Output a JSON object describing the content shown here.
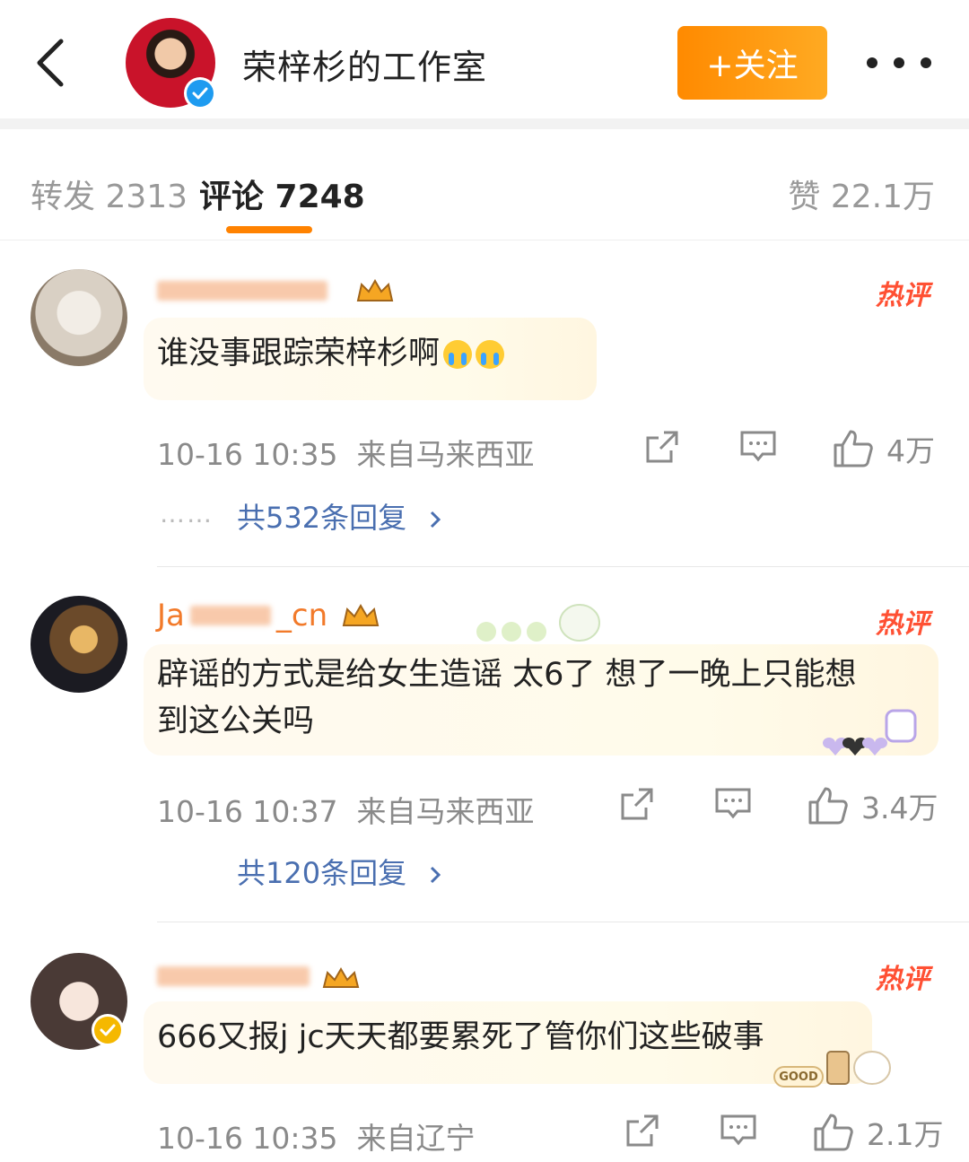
{
  "header": {
    "title": "荣梓杉的工作室",
    "follow_label": "+关注"
  },
  "tabs": {
    "repost": "转发 2313",
    "comment": "评论 7248",
    "like": "赞 22.1万"
  },
  "comments": [
    {
      "username_partial": "",
      "hot_label": "热评",
      "text": "谁没事跟踪荣梓杉啊",
      "time": "10-16 10:35",
      "location": "来自马来西亚",
      "likes": "4万",
      "replies": "共532条回复",
      "reply_ellipsis": "……"
    },
    {
      "username_partial": "Ja",
      "username_suffix": "_cn",
      "hot_label": "热评",
      "text": "辟谣的方式是给女生造谣 太6了 想了一晚上只能想到这公关吗",
      "text_line1": "辟谣的方式是给女生造谣 太6了 想了一晚上只能想",
      "text_line2": "到这公关吗",
      "time": "10-16 10:37",
      "location": "来自马来西亚",
      "likes": "3.4万",
      "replies": "共120条回复"
    },
    {
      "username_partial": "",
      "hot_label": "热评",
      "text": "666又报j jc天天都要累死了管你们这些破事",
      "time": "10-16 10:35",
      "location": "来自辽宁",
      "likes": "2.1万",
      "sticker_text": "GOOD"
    }
  ],
  "colors": {
    "accent": "#ff8200",
    "username": "#f27a2a",
    "hot": "#ff5033",
    "link": "#4a6fb0",
    "verified": "#1e9bf0"
  },
  "icons": [
    "back-arrow-icon",
    "verified-icon",
    "more-icon",
    "share-icon",
    "comment-icon",
    "like-icon",
    "chevron-right-icon",
    "crown-badge-icon"
  ]
}
